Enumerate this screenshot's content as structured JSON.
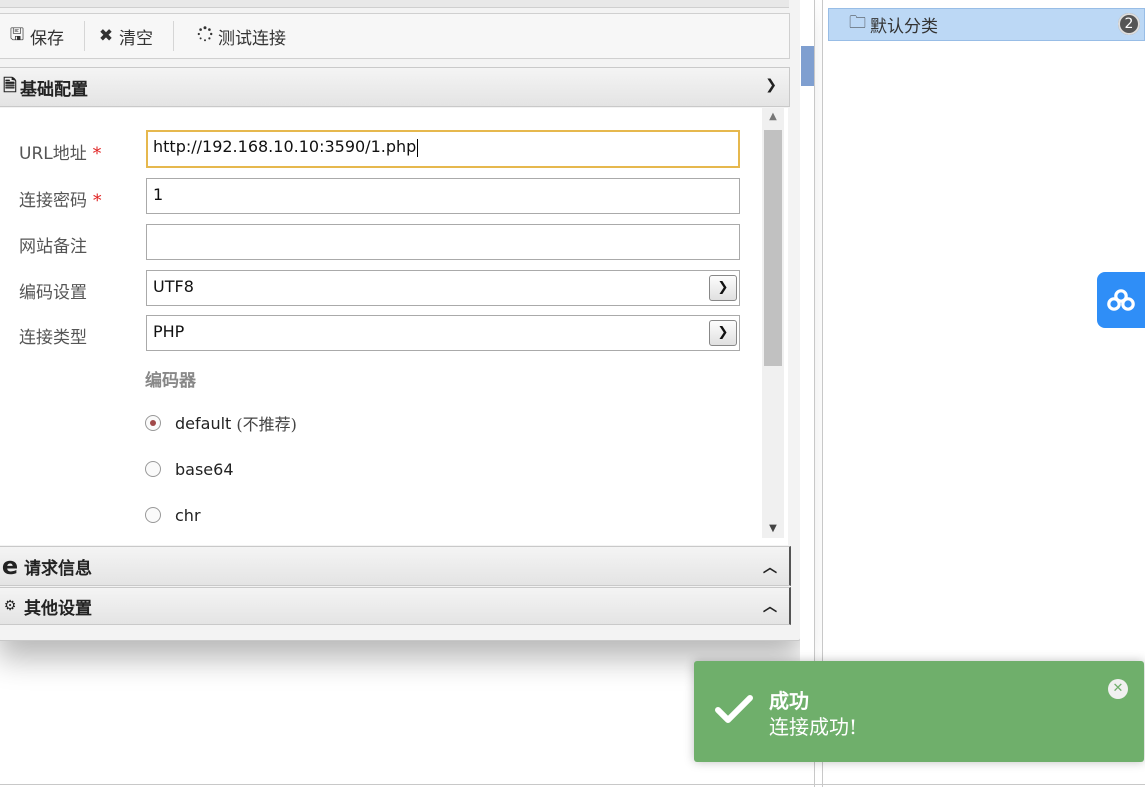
{
  "toolbar": {
    "save_label": "保存",
    "clear_label": "清空",
    "test_label": "测试连接"
  },
  "sections": {
    "basic": {
      "title": "基础配置",
      "icon": "file-text-icon",
      "state": "expanded"
    },
    "request": {
      "title": "请求信息",
      "icon": "ie-icon",
      "state": "collapsed"
    },
    "other": {
      "title": "其他设置",
      "icon": "cogs-icon",
      "state": "collapsed"
    }
  },
  "form": {
    "url": {
      "label": "URL地址",
      "required_mark": "*",
      "value": "http://192.168.10.10:3590/1.php"
    },
    "password": {
      "label": "连接密码",
      "required_mark": "*",
      "value": "1"
    },
    "note": {
      "label": "网站备注",
      "value": ""
    },
    "encoding": {
      "label": "编码设置",
      "value": "UTF8"
    },
    "type": {
      "label": "连接类型",
      "value": "PHP"
    },
    "encoder": {
      "title": "编码器",
      "options": [
        {
          "label": "default",
          "note": "(不推荐)",
          "checked": true
        },
        {
          "label": "base64",
          "checked": false
        },
        {
          "label": "chr",
          "checked": false
        }
      ]
    }
  },
  "category": {
    "name": "默认分类",
    "count": "2"
  },
  "toast": {
    "title": "成功",
    "message": "连接成功!"
  },
  "colors": {
    "toast_bg": "#6faf6b",
    "category_bg": "#bcd8f5",
    "baidu_blue": "#2f8ef7",
    "focus_border": "#e6b84e",
    "required": "#e02020"
  }
}
